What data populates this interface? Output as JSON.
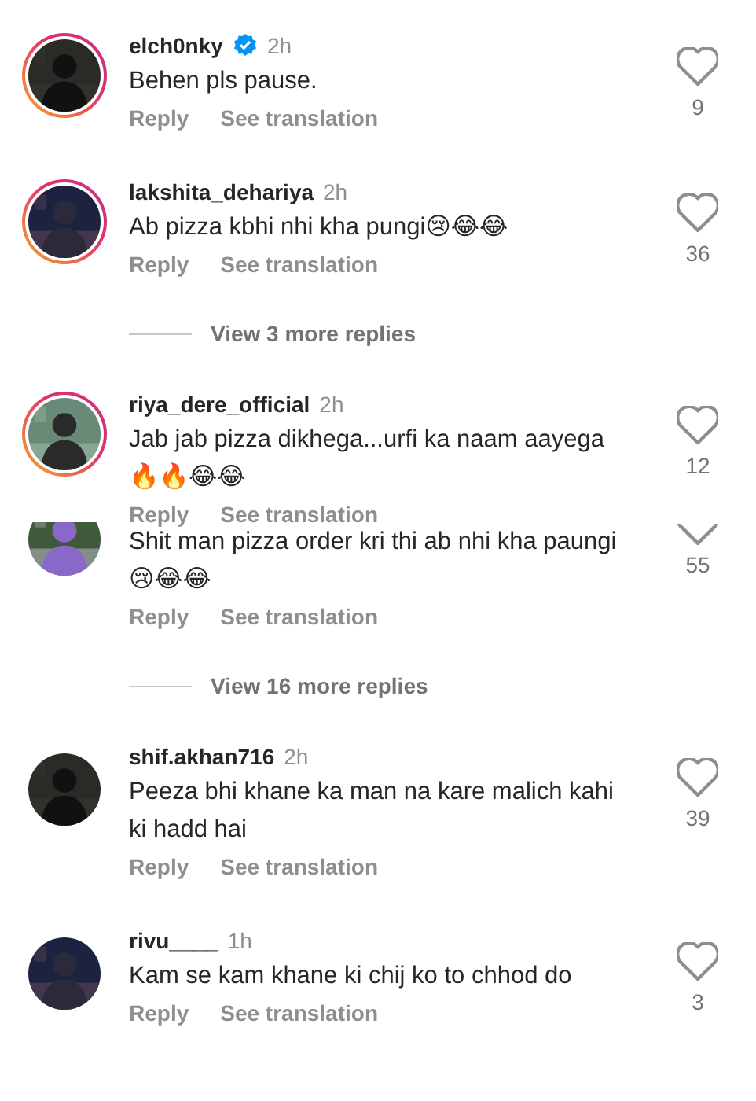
{
  "items": [
    {
      "kind": "comment",
      "username": "elch0nky",
      "verified": true,
      "story_ring": true,
      "time": "2h",
      "text": "Behen pls pause.",
      "likes": "9",
      "actions": [
        "Reply",
        "See translation"
      ]
    },
    {
      "kind": "comment",
      "username": "lakshita_dehariya",
      "verified": false,
      "story_ring": true,
      "time": "2h",
      "text": "Ab pizza kbhi nhi kha pungi😢😂😂",
      "likes": "36",
      "actions": [
        "Reply",
        "See translation"
      ]
    },
    {
      "kind": "view_replies",
      "label": "View 3 more replies"
    },
    {
      "kind": "comment",
      "username": "riya_dere_official",
      "verified": false,
      "story_ring": true,
      "time": "2h",
      "text": "Jab jab pizza dikhega...urfi ka naam aayega 🔥🔥😂😂",
      "likes": "12",
      "actions": [
        "Reply",
        "See translation"
      ]
    },
    {
      "kind": "overlapped_comment",
      "text": "Shit man pizza order kri thi ab nhi kha paungi 😢😂😂",
      "likes": "55",
      "actions": [
        "Reply",
        "See translation"
      ]
    },
    {
      "kind": "view_replies",
      "label": "View 16 more replies"
    },
    {
      "kind": "comment",
      "username": "shif.akhan716",
      "verified": false,
      "story_ring": false,
      "time": "2h",
      "text": "Peeza bhi khane ka man na kare malich kahi ki hadd hai",
      "likes": "39",
      "actions": [
        "Reply",
        "See translation"
      ]
    },
    {
      "kind": "comment",
      "username": "rivu____",
      "verified": false,
      "story_ring": false,
      "time": "1h",
      "text": "Kam se kam khane ki chij ko to chhod do",
      "likes": "3",
      "actions": [
        "Reply",
        "See translation"
      ]
    }
  ]
}
